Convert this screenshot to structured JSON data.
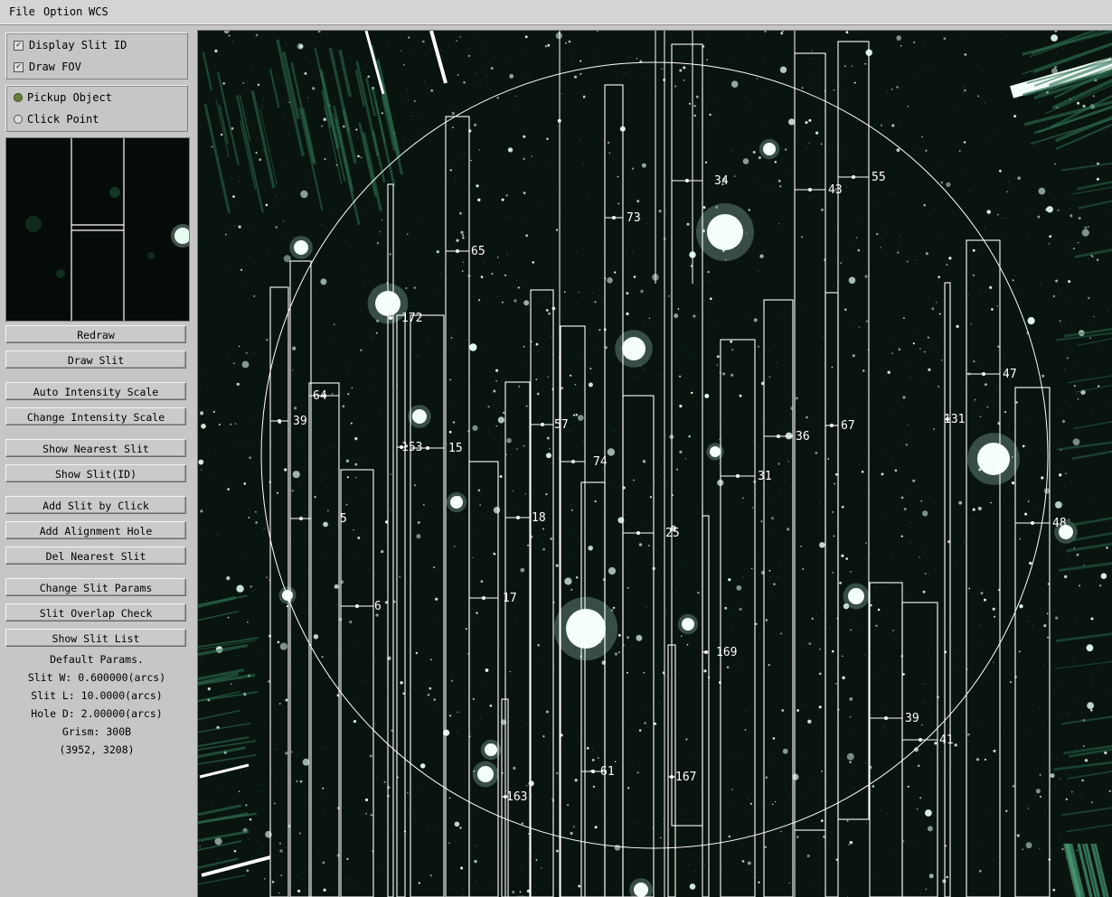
{
  "menubar": {
    "items": [
      {
        "label": "File"
      },
      {
        "label": "Option"
      },
      {
        "label": "WCS"
      }
    ]
  },
  "display_options": {
    "display_slit_id": {
      "label": "Display Slit ID",
      "checked": true
    },
    "draw_fov": {
      "label": "Draw FOV",
      "checked": true
    }
  },
  "click_mode": {
    "pickup_object": {
      "label": "Pickup Object",
      "selected": true
    },
    "click_point": {
      "label": "Click Point",
      "selected": false
    }
  },
  "buttons": {
    "redraw": "Redraw",
    "draw_slit": "Draw Slit",
    "auto_intensity": "Auto Intensity Scale",
    "change_intensity": "Change Intensity Scale",
    "show_nearest": "Show Nearest Slit",
    "show_slit_id": "Show Slit(ID)",
    "add_slit_click": "Add Slit by Click",
    "add_alignment": "Add Alignment Hole",
    "del_nearest": "Del Nearest Slit",
    "change_params": "Change Slit Params",
    "overlap_check": "Slit Overlap Check",
    "show_list": "Show Slit List"
  },
  "params": {
    "title": "Default Params.",
    "slit_w": "Slit W: 0.600000(arcs)",
    "slit_l": "Slit L: 10.0000(arcs)",
    "hole_d": "Hole D: 2.00000(arcs)",
    "grism": "Grism: 300B",
    "coords": "(3952, 3208)"
  },
  "colors": {
    "slit": "#ffffff",
    "sky": "#09140f",
    "star": "#e8fff4",
    "accent": "#6a7d3a"
  },
  "slits": [
    {
      "id": "65"
    },
    {
      "id": "172"
    },
    {
      "id": "64"
    },
    {
      "id": "39"
    },
    {
      "id": "153"
    },
    {
      "id": "15"
    },
    {
      "id": "5"
    },
    {
      "id": "6"
    },
    {
      "id": "57"
    },
    {
      "id": "74"
    },
    {
      "id": "18"
    },
    {
      "id": "17"
    },
    {
      "id": "163"
    },
    {
      "id": "73"
    },
    {
      "id": "25"
    },
    {
      "id": "61"
    },
    {
      "id": "34"
    },
    {
      "id": "169"
    },
    {
      "id": "167"
    },
    {
      "id": "31"
    },
    {
      "id": "36"
    },
    {
      "id": "43"
    },
    {
      "id": "55"
    },
    {
      "id": "67"
    },
    {
      "id": "131"
    },
    {
      "id": "47"
    },
    {
      "id": "48"
    },
    {
      "id": "39"
    },
    {
      "id": "41"
    }
  ]
}
